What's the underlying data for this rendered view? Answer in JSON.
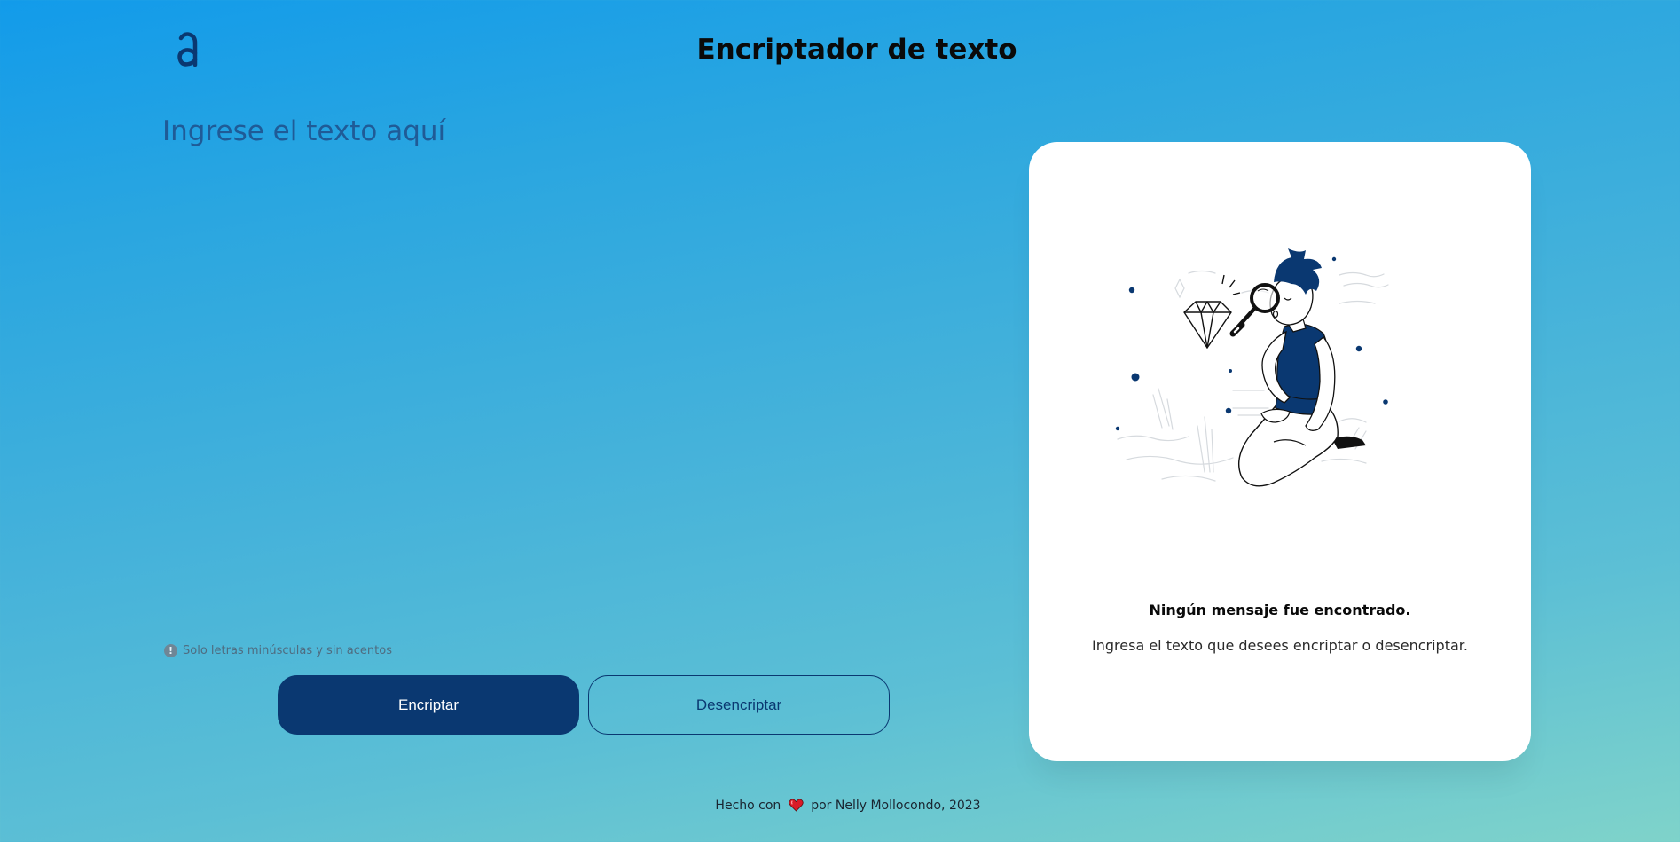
{
  "header": {
    "logo_letter": "a",
    "title": "Encriptador de texto"
  },
  "input": {
    "placeholder": "Ingrese el texto aquí",
    "value": ""
  },
  "hint": {
    "icon": "info-icon",
    "text": "Solo letras minúsculas y sin acentos"
  },
  "buttons": {
    "encrypt_label": "Encriptar",
    "decrypt_label": "Desencriptar"
  },
  "output_panel": {
    "illustration": "person-with-magnifying-glass",
    "title": "Ningún mensaje fue encontrado.",
    "message": "Ingresa el texto que desees encriptar o desencriptar."
  },
  "footer": {
    "prefix": "Hecho con",
    "icon": "heart-icon",
    "suffix": "por Nelly Mollocondo, 2023"
  },
  "colors": {
    "primary": "#0a3871",
    "panel_bg": "#ffffff",
    "background_start": "#129bea",
    "background_end": "#7fd3ca"
  }
}
